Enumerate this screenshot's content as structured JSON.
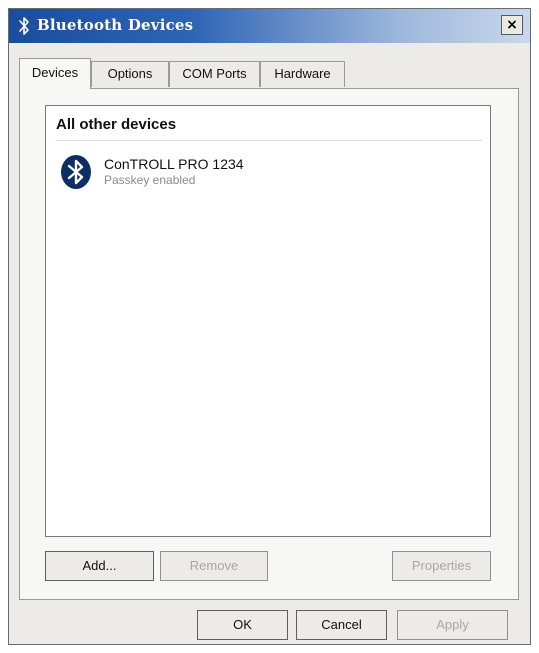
{
  "window": {
    "title": "Bluetooth Devices",
    "close_label": "×"
  },
  "tabs": [
    {
      "label": "Devices"
    },
    {
      "label": "Options"
    },
    {
      "label": "COM Ports"
    },
    {
      "label": "Hardware"
    }
  ],
  "device_list": {
    "group_header": "All other devices",
    "devices": [
      {
        "name": "ConTROLL PRO 1234",
        "status": "Passkey enabled",
        "icon": "bluetooth-icon"
      }
    ]
  },
  "panel_buttons": {
    "add": "Add...",
    "remove": "Remove",
    "properties": "Properties"
  },
  "dialog_buttons": {
    "ok": "OK",
    "cancel": "Cancel",
    "apply": "Apply"
  },
  "colors": {
    "title_bar_start": "#1a4d9c",
    "title_bar_end": "#c9d8ec",
    "bluetooth_icon": "#0b2f63",
    "disabled_text": "#a7a7a7"
  }
}
